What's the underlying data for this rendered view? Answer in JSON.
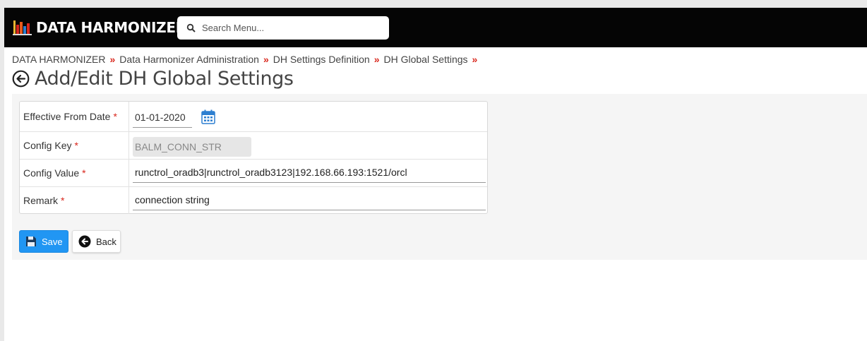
{
  "header": {
    "brand": "DATA HARMONIZER",
    "brand_icon": "bar-chart-logo-icon",
    "search_placeholder": "Search Menu..."
  },
  "breadcrumb": {
    "items": [
      "DATA HARMONIZER",
      "Data Harmonizer Administration",
      "DH Settings Definition",
      "DH Global Settings"
    ],
    "separator": "»"
  },
  "page": {
    "title": "Add/Edit DH Global Settings",
    "back_icon": "circle-arrow-left-icon"
  },
  "form": {
    "effective_from_date": {
      "label": "Effective From Date",
      "required_mark": "*",
      "value": "01-01-2020"
    },
    "config_key": {
      "label": "Config Key",
      "required_mark": "*",
      "value": "BALM_CONN_STR"
    },
    "config_value": {
      "label": "Config Value",
      "required_mark": "*",
      "value": "runctrol_oradb3|runctrol_oradb3123|192.168.66.193:1521/orcl"
    },
    "remark": {
      "label": "Remark",
      "required_mark": "*",
      "value": "connection string"
    }
  },
  "actions": {
    "save_label": "Save",
    "back_label": "Back"
  },
  "colors": {
    "topbar": "#050505",
    "accent": "#2196f3",
    "required": "#d9261c"
  }
}
